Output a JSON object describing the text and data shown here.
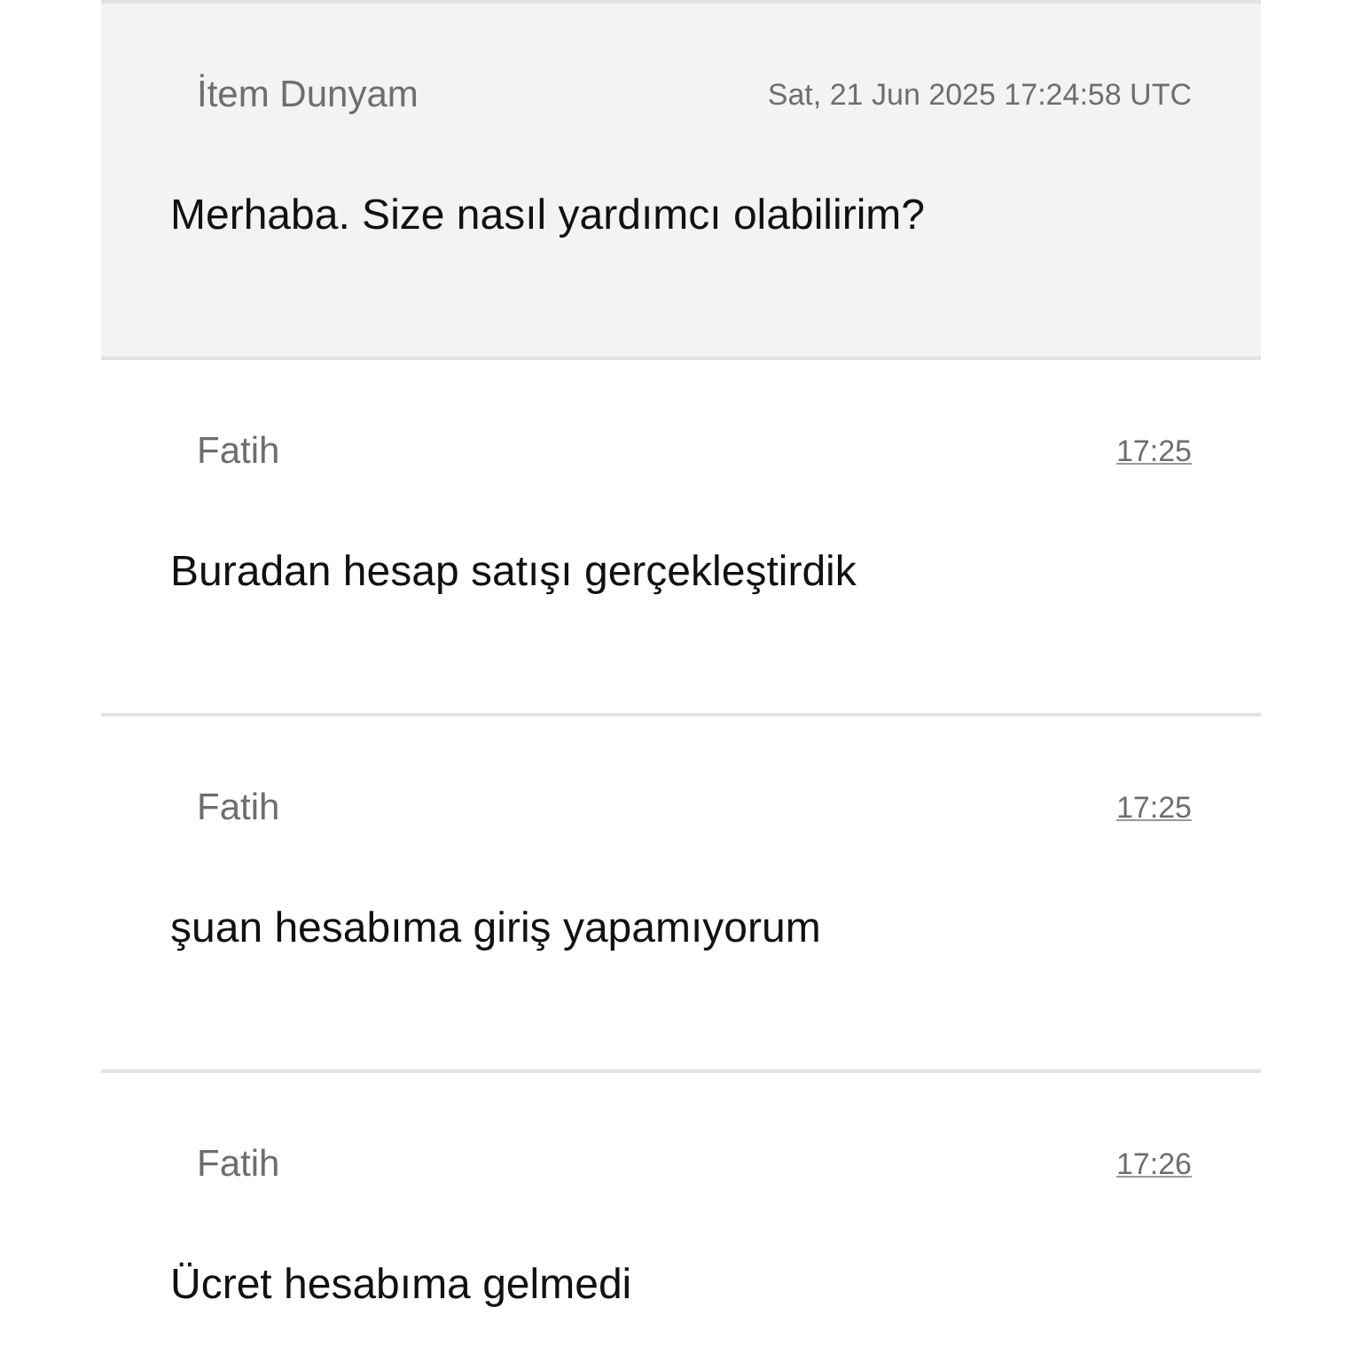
{
  "messages": [
    {
      "author": "İtem Dunyam",
      "time": "Sat, 21 Jun 2025 17:24:58 UTC",
      "time_underlined": false,
      "text": "Merhaba. Size nasıl yardımcı olabilirim?",
      "highlighted": true
    },
    {
      "author": "Fatih",
      "time": "17:25",
      "time_underlined": true,
      "text": "Buradan hesap satışı gerçekleştirdik",
      "highlighted": false
    },
    {
      "author": "Fatih",
      "time": "17:25",
      "time_underlined": true,
      "text": "şuan hesabıma giriş yapamıyorum",
      "highlighted": false
    },
    {
      "author": "Fatih",
      "time": "17:26",
      "time_underlined": true,
      "text": "Ücret hesabıma gelmedi",
      "highlighted": false
    }
  ]
}
